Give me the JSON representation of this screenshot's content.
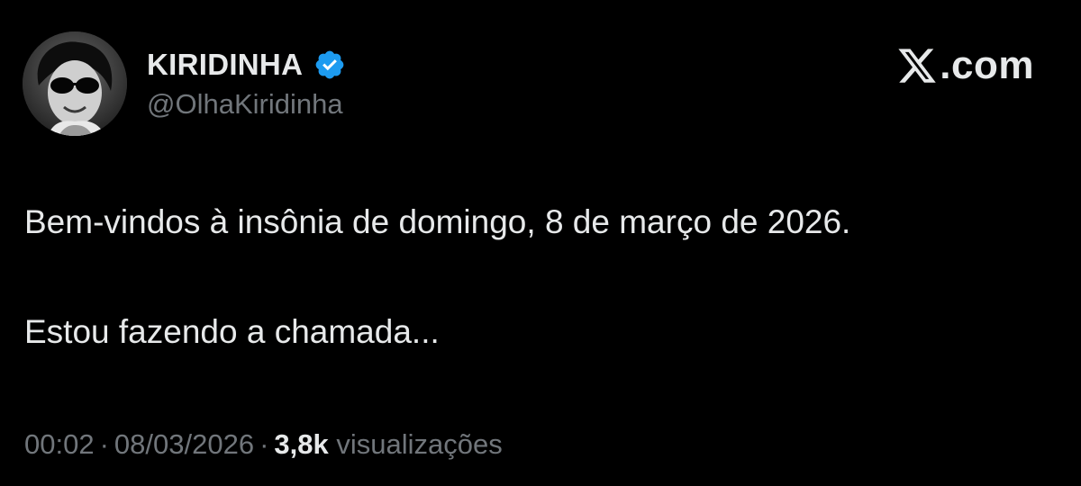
{
  "tweet": {
    "author": {
      "display_name": "KIRIDINHA",
      "handle": "@OlhaKiridinha",
      "verified": true,
      "verified_color": "#1d9bf0",
      "avatar": "black-and-white portrait of woman in sunglasses"
    },
    "brand": {
      "logo_icon": "x-logo-icon",
      "domain_text": ".com"
    },
    "body": {
      "line1": "Bem-vindos à insônia de domingo, 8 de março de 2026.",
      "line2": "Estou fazendo a chamada..."
    },
    "meta": {
      "time": "00:02",
      "separator": "·",
      "date": "08/03/2026",
      "views_count": "3,8k",
      "views_label": "visualizações"
    }
  },
  "colors": {
    "background": "#000000",
    "primary_text": "#e7e9ea",
    "secondary_text": "#71767b",
    "verified_blue": "#1d9bf0"
  }
}
